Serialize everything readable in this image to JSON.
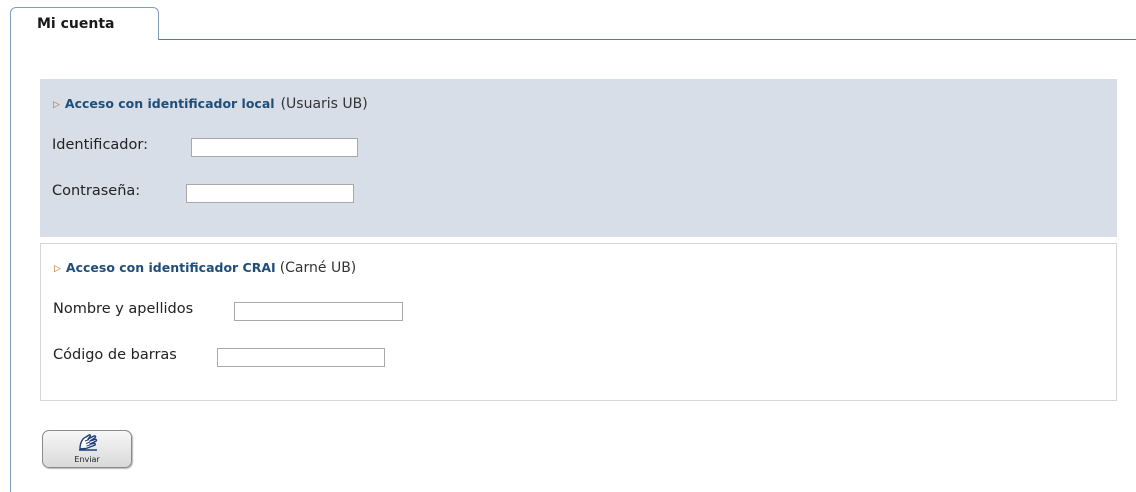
{
  "tab": {
    "label": "Mi cuenta"
  },
  "local_access": {
    "link_label": "Acceso con identificador local",
    "note": "(Usuaris UB)",
    "fields": [
      {
        "label": "Identificador:",
        "value": "",
        "placeholder": ""
      },
      {
        "label": "Contraseña:",
        "value": "",
        "placeholder": ""
      }
    ]
  },
  "crai_access": {
    "link_label": "Acceso con identificador CRAI",
    "note": "(Carné UB)",
    "fields": [
      {
        "label": "Nombre y apellidos",
        "value": "",
        "placeholder": ""
      },
      {
        "label": "Código de barras",
        "value": "",
        "placeholder": ""
      }
    ]
  },
  "submit": {
    "label": "Enviar",
    "icon": "hand-send-icon"
  },
  "colors": {
    "panel_local_bg": "#d8dee8",
    "link": "#1f4e79",
    "arrow": "#b4621c",
    "tab_border": "#4f7fa6"
  }
}
